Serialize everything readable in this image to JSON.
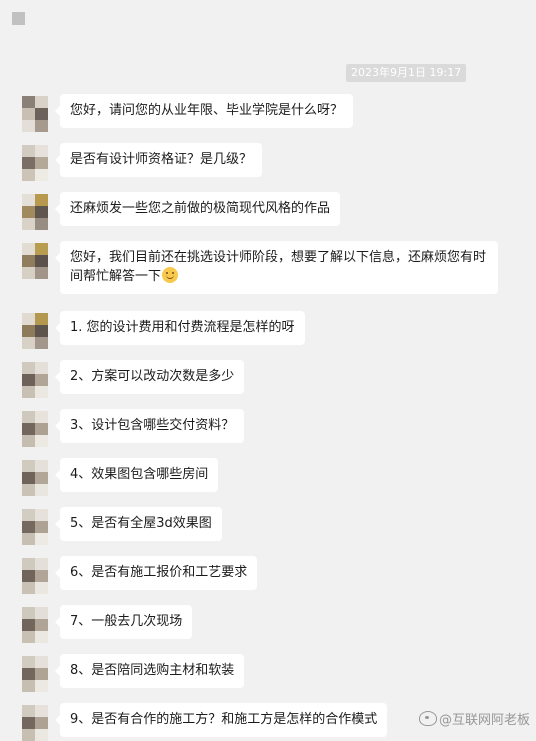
{
  "header": {
    "window_icon": "app-icon"
  },
  "chat": {
    "timestamp": "2023年9月1日 19:17",
    "messages": [
      {
        "text": "您好，请问您的从业年限、毕业学院是什么呀？"
      },
      {
        "text": "是否有设计师资格证？是几级？"
      },
      {
        "text": "还麻烦发一些您之前做的极简现代风格的作品"
      },
      {
        "text": "您好，我们目前还在挑选设计师阶段，想要了解以下信息，还麻烦您有时间帮忙解答一下",
        "emoji": "smiling-face-emoji"
      },
      {
        "text": "1. 您的设计费用和付费流程是怎样的呀"
      },
      {
        "text": "2、方案可以改动次数是多少"
      },
      {
        "text": "3、设计包含哪些交付资料？"
      },
      {
        "text": "4、效果图包含哪些房间"
      },
      {
        "text": "5、是否有全屋3d效果图"
      },
      {
        "text": "6、是否有施工报价和工艺要求"
      },
      {
        "text": "7、一般去几次现场"
      },
      {
        "text": "8、是否陪同选购主材和软装"
      },
      {
        "text": "9、是否有合作的施工方？和施工方是怎样的合作模式"
      }
    ]
  },
  "watermark": {
    "text": "@互联网阿老板",
    "icon": "weibo-icon"
  },
  "colors": {
    "background": "#f1f1f1",
    "bubble": "#ffffff",
    "timestamp_bg": "#dadada",
    "emoji": "#f7c94c"
  }
}
